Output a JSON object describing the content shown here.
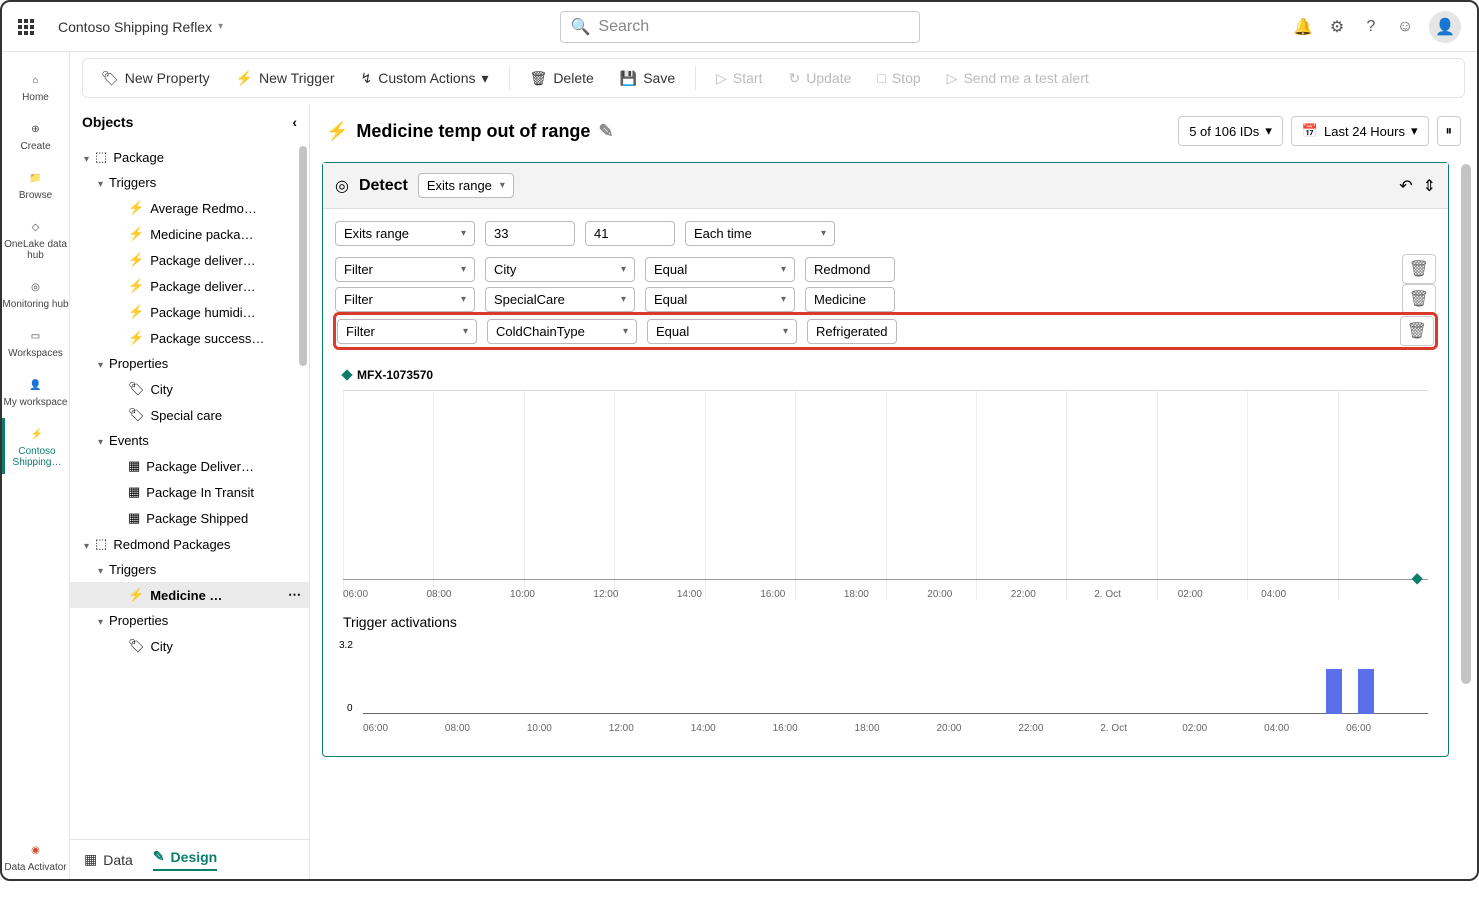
{
  "app_title": "Contoso Shipping Reflex",
  "search_placeholder": "Search",
  "rail": [
    {
      "label": "Home"
    },
    {
      "label": "Create"
    },
    {
      "label": "Browse"
    },
    {
      "label": "OneLake data hub"
    },
    {
      "label": "Monitoring hub"
    },
    {
      "label": "Workspaces"
    },
    {
      "label": "My workspace"
    },
    {
      "label": "Contoso Shipping…"
    }
  ],
  "rail_bottom_label": "Data Activator",
  "toolbar": {
    "new_property": "New Property",
    "new_trigger": "New Trigger",
    "custom_actions": "Custom Actions",
    "delete": "Delete",
    "save": "Save",
    "start": "Start",
    "update": "Update",
    "stop": "Stop",
    "test": "Send me a test alert"
  },
  "panel": {
    "title": "Objects",
    "tree": [
      {
        "label": "Package",
        "indent": 0,
        "chev": true,
        "icon": "cube"
      },
      {
        "label": "Triggers",
        "indent": 1,
        "chev": true
      },
      {
        "label": "Average Redmo…",
        "indent": 3,
        "icon": "bolt"
      },
      {
        "label": "Medicine packa…",
        "indent": 3,
        "icon": "bolt"
      },
      {
        "label": "Package deliver…",
        "indent": 3,
        "icon": "bolt"
      },
      {
        "label": "Package deliver…",
        "indent": 3,
        "icon": "bolt"
      },
      {
        "label": "Package humidi…",
        "indent": 3,
        "icon": "bolt"
      },
      {
        "label": "Package success…",
        "indent": 3,
        "icon": "bolt"
      },
      {
        "label": "Properties",
        "indent": 1,
        "chev": true
      },
      {
        "label": "City",
        "indent": 3,
        "icon": "tag"
      },
      {
        "label": "Special care",
        "indent": 3,
        "icon": "tag"
      },
      {
        "label": "Events",
        "indent": 1,
        "chev": true
      },
      {
        "label": "Package Deliver…",
        "indent": 3,
        "icon": "grid"
      },
      {
        "label": "Package In Transit",
        "indent": 3,
        "icon": "grid"
      },
      {
        "label": "Package Shipped",
        "indent": 3,
        "icon": "grid"
      },
      {
        "label": "Redmond Packages",
        "indent": 0,
        "chev": true,
        "icon": "cube"
      },
      {
        "label": "Triggers",
        "indent": 1,
        "chev": true
      },
      {
        "label": "Medicine …",
        "indent": 3,
        "icon": "bolt-filled",
        "selected": true,
        "more": true
      },
      {
        "label": "Properties",
        "indent": 1,
        "chev": true
      },
      {
        "label": "City",
        "indent": 3,
        "icon": "tag"
      }
    ]
  },
  "bottom_tabs": {
    "data": "Data",
    "design": "Design"
  },
  "canvas": {
    "title": "Medicine temp out of range",
    "ids_label": "5 of 106 IDs",
    "time_label": "Last 24 Hours",
    "detect_label": "Detect",
    "detect_mode": "Exits range",
    "row1": {
      "a": "Exits range",
      "b": "33",
      "c": "41",
      "d": "Each time"
    },
    "filters": [
      {
        "type": "Filter",
        "field": "City",
        "op": "Equal",
        "val": "Redmond"
      },
      {
        "type": "Filter",
        "field": "SpecialCare",
        "op": "Equal",
        "val": "Medicine"
      },
      {
        "type": "Filter",
        "field": "ColdChainType",
        "op": "Equal",
        "val": "Refrigerated",
        "hl": true
      }
    ],
    "legend_id": "MFX-1073570",
    "trigger_section": "Trigger activations",
    "y_top": "3.2",
    "y_zero": "0"
  },
  "chart_data": {
    "type": "line",
    "title": "",
    "series": [
      {
        "name": "MFX-1073570",
        "values": [
          null,
          null,
          null,
          null,
          null,
          null,
          null,
          null,
          null,
          null,
          null,
          null,
          40
        ]
      }
    ],
    "x": [
      "06:00",
      "08:00",
      "10:00",
      "12:00",
      "14:00",
      "16:00",
      "18:00",
      "20:00",
      "22:00",
      "2. Oct",
      "02:00",
      "04:00",
      ""
    ],
    "ylim": [
      0,
      45
    ],
    "secondary": {
      "type": "bar",
      "title": "Trigger activations",
      "x": [
        "06:00",
        "08:00",
        "10:00",
        "12:00",
        "14:00",
        "16:00",
        "18:00",
        "20:00",
        "22:00",
        "2. Oct",
        "02:00",
        "04:00",
        "06:00"
      ],
      "values": [
        0,
        0,
        0,
        0,
        0,
        0,
        0,
        0,
        0,
        0,
        0,
        3.0,
        3.0
      ],
      "ylim": [
        0,
        3.2
      ]
    }
  }
}
